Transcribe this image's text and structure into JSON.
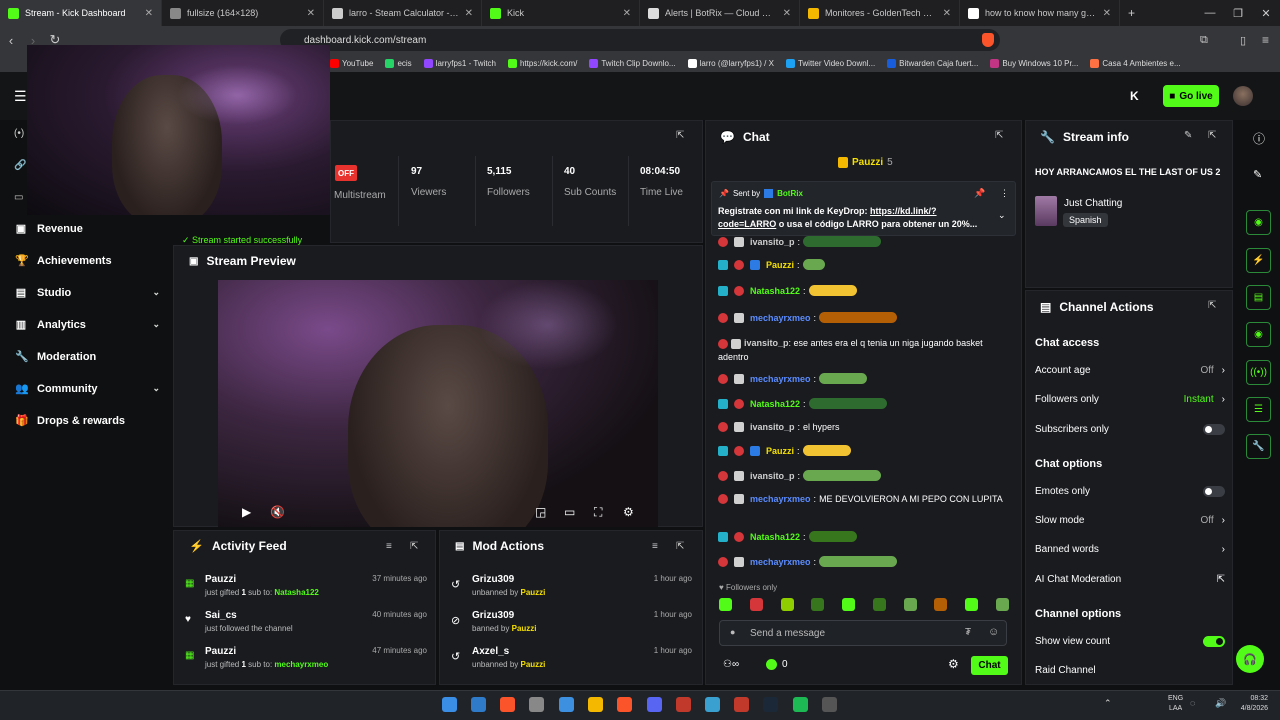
{
  "browser": {
    "tabs": [
      {
        "title": "Stream - Kick Dashboard",
        "color": "#53fc18"
      },
      {
        "title": "fullsize (164×128)",
        "color": "#888888"
      },
      {
        "title": "larro - Steam Calculator - 76561198",
        "color": "#cccccc"
      },
      {
        "title": "Kick",
        "color": "#53fc18"
      },
      {
        "title": "Alerts | BotRix — Cloud Streaming E",
        "color": "#dddddd"
      },
      {
        "title": "Monitores - GoldenTech Store",
        "color": "#f5b800"
      },
      {
        "title": "how to know how many games i di",
        "color": "#ffffff"
      }
    ],
    "url": "dashboard.kick.com/stream",
    "bookmarks": [
      {
        "label": "YouTube",
        "color": "#ff0000"
      },
      {
        "label": "ecis",
        "color": "#25d366"
      },
      {
        "label": "larryfps1 - Twitch",
        "color": "#9146ff"
      },
      {
        "label": "https://kick.com/",
        "color": "#53fc18"
      },
      {
        "label": "Twitch Clip Downlo...",
        "color": "#9146ff"
      },
      {
        "label": "larro (@larryfps1) / X",
        "color": "#ffffff"
      },
      {
        "label": "Twitter Video Downl...",
        "color": "#1da1f2"
      },
      {
        "label": "Bitwarden Caja fuert...",
        "color": "#175ddc"
      },
      {
        "label": "Buy Windows 10 Pr...",
        "color": "#c13584"
      },
      {
        "label": "Casa 4 Ambientes e...",
        "color": "#ff7043"
      }
    ]
  },
  "header": {
    "go_live": "Go live"
  },
  "sidebar": {
    "items": [
      {
        "label": "Revenue",
        "icon": "money-icon",
        "glyph": "▣"
      },
      {
        "label": "Achievements",
        "icon": "trophy-icon",
        "glyph": "🏆"
      },
      {
        "label": "Studio",
        "icon": "studio-icon",
        "glyph": "▤"
      },
      {
        "label": "Analytics",
        "icon": "chart-icon",
        "glyph": "▥"
      },
      {
        "label": "Moderation",
        "icon": "wrench-icon",
        "glyph": "🔧"
      },
      {
        "label": "Community",
        "icon": "people-icon",
        "glyph": "👥"
      },
      {
        "label": "Drops & rewards",
        "icon": "gift-icon",
        "glyph": "🎁"
      }
    ]
  },
  "stats": {
    "off_badge": "OFF",
    "multistream": "Multistream",
    "viewers_value": "97",
    "viewers_label": "Viewers",
    "followers_value": "5,115",
    "followers_label": "Followers",
    "subs_value": "40",
    "subs_label": "Sub Counts",
    "time_value": "08:04:50",
    "time_label": "Time Live",
    "status": "Stream started successfully"
  },
  "preview": {
    "title": "Stream Preview"
  },
  "activity": {
    "title": "Activity Feed",
    "rows": [
      {
        "name": "Pauzzi",
        "pre": "just gifted ",
        "count": "1",
        "mid": " sub to: ",
        "target": "Natasha122",
        "time": "37 minutes ago"
      },
      {
        "name": "Sai_cs",
        "pre": "just followed the channel",
        "count": "",
        "mid": "",
        "target": "",
        "time": "40 minutes ago"
      },
      {
        "name": "Pauzzi",
        "pre": "just gifted ",
        "count": "1",
        "mid": " sub to: ",
        "target": "mechayrxmeo",
        "time": "47 minutes ago"
      }
    ]
  },
  "mod": {
    "title": "Mod Actions",
    "rows": [
      {
        "name": "Grizu309",
        "action": "unbanned by",
        "by": "Pauzzi",
        "time": "1 hour ago"
      },
      {
        "name": "Grizu309",
        "action": "banned by",
        "by": "Pauzzi",
        "time": "1 hour ago"
      },
      {
        "name": "Axzel_s",
        "action": "unbanned by",
        "by": "Pauzzi",
        "time": "1 hour ago"
      }
    ]
  },
  "chat": {
    "title": "Chat",
    "top_gifter": "Pauzzi",
    "top_gifter_count": "5",
    "pinned_sent_by": "Sent by",
    "pinned_author": "BotRix",
    "pinned_text_a": "Registrate con mi link de KeyDrop: ",
    "pinned_link": "https://kd.link/?code=LARRO",
    "pinned_text_b": " o usa el código LARRO para obtener un 20%...",
    "messages": [
      {
        "user": "ivansito_p",
        "text": "",
        "color": "#cfcfcf",
        "emote": "#2e6b2e"
      },
      {
        "user": "Pauzzi",
        "text": "",
        "color": "#f5e000",
        "emote": "#6aa84f"
      },
      {
        "user": "Natasha122",
        "text": "",
        "color": "#53fc18",
        "emote": "#f1c232"
      },
      {
        "user": "mechayrxmeo",
        "text": "",
        "color": "#5b8cff",
        "emote": "#b45f06"
      },
      {
        "user": "ivansito_p",
        "text": "ese antes era el q tenia un niga jugando basket adentro",
        "color": "#cfcfcf",
        "emote": ""
      },
      {
        "user": "mechayrxmeo",
        "text": "",
        "color": "#5b8cff",
        "emote": "#6aa84f"
      },
      {
        "user": "Natasha122",
        "text": "",
        "color": "#53fc18",
        "emote": "#2e6b2e"
      },
      {
        "user": "ivansito_p",
        "text": "el hypers",
        "color": "#cfcfcf",
        "emote": ""
      },
      {
        "user": "Pauzzi",
        "text": "",
        "color": "#f5e000",
        "emote": "#f1c232"
      },
      {
        "user": "ivansito_p",
        "text": "",
        "color": "#cfcfcf",
        "emote": "#6aa84f"
      },
      {
        "user": "mechayrxmeo",
        "text": "ME DEVOLVIERON A MI PEPO CON LUPITA",
        "color": "#5b8cff",
        "emote": ""
      },
      {
        "user": "Natasha122",
        "text": "",
        "color": "#53fc18",
        "emote": "#38761d"
      },
      {
        "user": "mechayrxmeo",
        "text": "",
        "color": "#5b8cff",
        "emote": "#6aa84f"
      }
    ],
    "followers_only": "Followers only",
    "placeholder": "Send a message",
    "send": "Chat",
    "viewer_count": "0"
  },
  "stream_info": {
    "title": "Stream info",
    "stream_title": "HOY ARRANCAMOS EL THE LAST OF US 2",
    "category": "Just Chatting",
    "language": "Spanish"
  },
  "channel_actions": {
    "title": "Channel Actions",
    "chat_access": "Chat access",
    "account_age": "Account age",
    "account_age_val": "Off",
    "followers_only": "Followers only",
    "followers_only_val": "Instant",
    "subscribers_only": "Subscribers only",
    "chat_options": "Chat options",
    "emotes_only": "Emotes only",
    "slow_mode": "Slow mode",
    "slow_mode_val": "Off",
    "banned_words": "Banned words",
    "ai_moderation": "AI Chat Moderation",
    "channel_options": "Channel options",
    "show_view_count": "Show view count",
    "raid_channel": "Raid Channel"
  },
  "taskbar": {
    "lang": "ENG",
    "region": "LAA",
    "time": "08:32",
    "date": "4/8/2026"
  }
}
